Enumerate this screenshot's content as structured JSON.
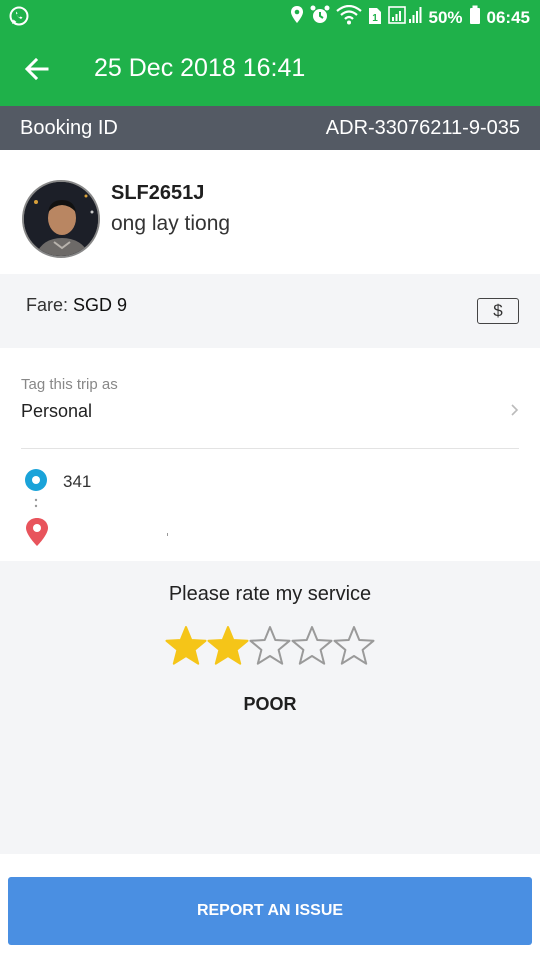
{
  "status_bar": {
    "battery_percent": "50%",
    "time": "06:45",
    "icons": [
      "whatsapp-icon",
      "location-icon",
      "alarm-icon",
      "wifi-icon",
      "sim-icon",
      "signal-icon",
      "battery-icon"
    ]
  },
  "header": {
    "title": "25 Dec 2018 16:41",
    "back_icon": "arrow-left-icon"
  },
  "booking": {
    "label": "Booking ID",
    "id": "ADR-33076211-9-035"
  },
  "driver": {
    "plate": "SLF2651J",
    "name": "ong lay tiong"
  },
  "fare": {
    "label": "Fare:",
    "amount": "SGD 9",
    "payment_icon": "cash-icon",
    "payment_symbol": "$"
  },
  "tag": {
    "label": "Tag this trip as",
    "value": "Personal"
  },
  "route": {
    "pickup": "341",
    "dropoff": ""
  },
  "rating": {
    "prompt": "Please rate my service",
    "stars_filled": 2,
    "stars_total": 5,
    "verdict": "POOR",
    "star_filled_color": "#f5c518",
    "star_empty_color": "#9a9a9a"
  },
  "actions": {
    "report_label": "REPORT AN ISSUE"
  },
  "colors": {
    "brand_green": "#1fb14a",
    "booking_bar": "#545a64",
    "report_button": "#4a8fe2",
    "pickup_blue": "#1aa3d9",
    "dropoff_red": "#e8545c"
  }
}
